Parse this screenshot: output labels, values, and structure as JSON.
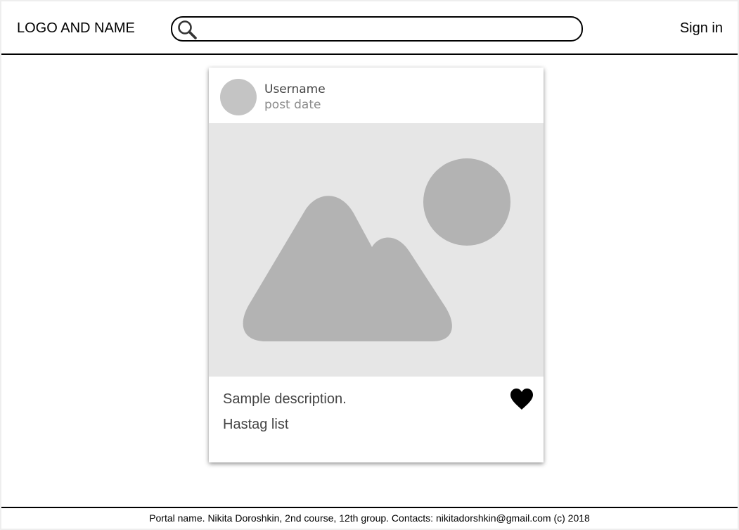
{
  "header": {
    "logo_text": "LOGO AND NAME",
    "search_placeholder": "",
    "search_value": "",
    "sign_in_label": "Sign in"
  },
  "post": {
    "username": "Username",
    "post_date": "post date",
    "description": "Sample description.",
    "hashtags": "Hastag list",
    "image_icon": "image-placeholder-icon",
    "like_icon": "heart-icon"
  },
  "footer": {
    "text": "Portal name. Nikita Doroshkin, 2nd course, 12th group. Contacts: nikitadorshkin@gmail.com  (c) 2018"
  },
  "colors": {
    "placeholder_bg": "#e6e6e6",
    "placeholder_shape": "#b3b3b3",
    "avatar": "#c4c4c4",
    "text": "#444444",
    "muted_text": "#8a8a8a"
  }
}
